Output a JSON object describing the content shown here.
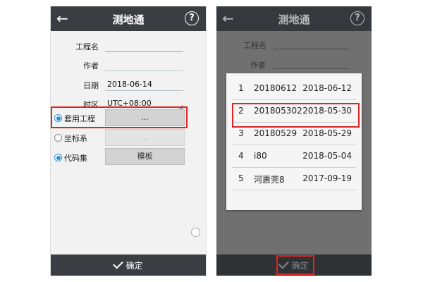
{
  "left_screen": {
    "title": "测地通",
    "back_icon": "arrow-left-icon",
    "help_label": "?",
    "fields": {
      "project_name": {
        "label": "工程名",
        "value": ""
      },
      "author": {
        "label": "作者",
        "value": ""
      },
      "date": {
        "label": "日期",
        "value": "2018-06-14"
      },
      "timezone": {
        "label": "时区",
        "value": "UTC+08:00"
      }
    },
    "options": {
      "apply_project": {
        "label": "套用工程",
        "button": "...",
        "selected": true
      },
      "coord_system": {
        "label": "坐标系",
        "button": "...",
        "selected": false
      },
      "code_set": {
        "label": "代码集",
        "button": "模板",
        "selected": true
      }
    },
    "confirm_label": "确定"
  },
  "right_screen": {
    "title": "测地通",
    "back_icon": "arrow-left-icon",
    "help_label": "?",
    "bg_labels": {
      "project_name": "工程名",
      "author": "作者"
    },
    "project_list": [
      {
        "no": "1",
        "name": "20180612",
        "date": "2018-06-12"
      },
      {
        "no": "2",
        "name": "201805302",
        "date": "2018-05-30",
        "highlighted": true
      },
      {
        "no": "3",
        "name": "20180529",
        "date": "2018-05-29"
      },
      {
        "no": "4",
        "name": "i80",
        "date": "2018-05-04"
      },
      {
        "no": "5",
        "name": "河惠莞8",
        "date": "2017-09-19"
      }
    ],
    "confirm_label": "确定"
  },
  "colors": {
    "highlight": "#e02424",
    "radio_on": "#2c8fd1",
    "topbar": "#3a3d41"
  }
}
